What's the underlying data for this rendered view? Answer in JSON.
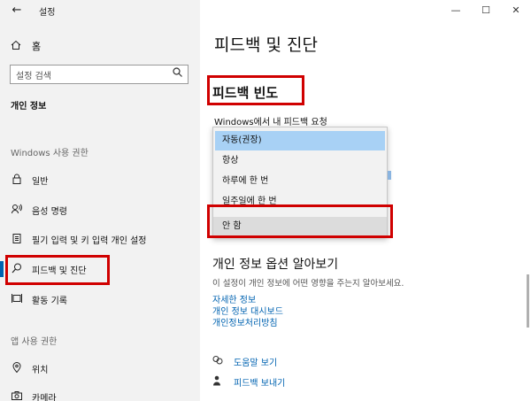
{
  "window": {
    "title": "설정",
    "back_glyph": "←",
    "minimize_glyph": "—",
    "maximize_glyph": "☐",
    "close_glyph": "✕"
  },
  "sidebar": {
    "home_label": "홈",
    "search_placeholder": "설정 검색",
    "privacy_header": "개인 정보",
    "windows_perm_header": "Windows 사용 권한",
    "app_perm_header": "앱 사용 권한",
    "items": [
      {
        "label": "일반",
        "icon": "lock-icon"
      },
      {
        "label": "음성 명령",
        "icon": "speech-icon"
      },
      {
        "label": "필기 입력 및 키 입력 개인 설정",
        "icon": "clipboard-icon"
      },
      {
        "label": "피드백 및 진단",
        "icon": "feedback-icon",
        "active": true
      },
      {
        "label": "활동 기록",
        "icon": "timeline-icon"
      }
    ],
    "app_items": [
      {
        "label": "위치",
        "icon": "location-icon"
      },
      {
        "label": "카메라",
        "icon": "camera-icon"
      }
    ]
  },
  "main": {
    "page_title": "피드백 및 진단",
    "section_title": "피드백 빈도",
    "request_label": "Windows에서 내 피드백 요청",
    "options": [
      "자동(권장)",
      "항상",
      "하루에 한 번",
      "일주일에 한 번",
      "안 함"
    ],
    "selected_option": "자동(권장)",
    "info_title": "개인 정보 옵션 알아보기",
    "info_desc": "이 설정이 개인 정보에 어떤 영향을 주는지 알아보세요.",
    "links": [
      "자세한 정보",
      "개인 정보 대시보드",
      "개인정보처리방침"
    ],
    "help_label": "도움말 보기",
    "feedback_label": "피드백 보내기"
  },
  "colors": {
    "accent": "#0063b1",
    "highlight_red": "#d00000",
    "selected_bg": "#a8d1f5",
    "sidebar_bg": "#f2f2f2"
  }
}
